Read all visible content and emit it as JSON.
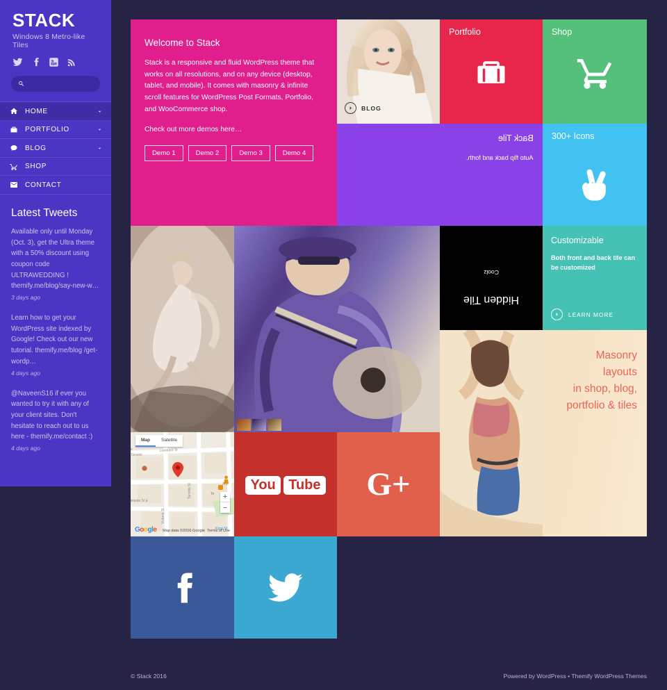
{
  "sidebar": {
    "logo": "STACK",
    "tagline": "Windows 8 Metro-like Tiles",
    "social": [
      {
        "name": "twitter-icon",
        "label": "Twitter"
      },
      {
        "name": "facebook-icon",
        "label": "Facebook"
      },
      {
        "name": "youtube-icon",
        "label": "YouTube"
      },
      {
        "name": "rss-icon",
        "label": "RSS"
      }
    ],
    "search": {
      "placeholder": "",
      "value": "",
      "icon": "search-icon"
    },
    "nav": [
      {
        "label": "HOME",
        "icon": "home-icon",
        "has_chevron": true,
        "active": true
      },
      {
        "label": "PORTFOLIO",
        "icon": "briefcase-icon",
        "has_chevron": true,
        "active": false
      },
      {
        "label": "BLOG",
        "icon": "comment-icon",
        "has_chevron": true,
        "active": false
      },
      {
        "label": "SHOP",
        "icon": "cart-icon",
        "has_chevron": false,
        "active": false
      },
      {
        "label": "CONTACT",
        "icon": "envelope-icon",
        "has_chevron": false,
        "active": false
      }
    ],
    "tweets_title": "Latest Tweets",
    "tweets": [
      {
        "text": "Available only until Monday (Oct. 3), get the Ultra theme with a 50% discount using coupon code ULTRAWEDDING ! themify.me/blog/say-new-w…",
        "ago": "3 days ago"
      },
      {
        "text": "Learn how to get your WordPress site indexed by Google! Check out our new tutorial. themify.me/blog /get-wordp…",
        "ago": "4 days ago"
      },
      {
        "text": "@NaveenS16 if ever you wanted to try it with any of your client sites. Don't hesitate to reach out to us here - themify.me/contact :)",
        "ago": "4 days ago"
      }
    ]
  },
  "tiles": {
    "welcome": {
      "title": "Welcome to Stack",
      "body": "Stack is a responsive and fluid WordPress theme that works on all resolutions, and on any device (desktop, tablet, and mobile). It comes with masonry & infinite scroll features for WordPress Post Formats, Portfolio, and WooCommerce shop.",
      "cta": "Check out more demos here…",
      "buttons": [
        "Demo 1",
        "Demo 2",
        "Demo 3",
        "Demo 4"
      ],
      "color": "#e01e8c"
    },
    "blog": {
      "cta_label": "BLOG",
      "icon": "chevron-right-circle-icon"
    },
    "portfolio": {
      "title": "Portfolio",
      "icon": "briefcase-icon",
      "color": "#e8264c"
    },
    "shop": {
      "title": "Shop",
      "icon": "cart-icon",
      "color": "#55bf7c"
    },
    "back": {
      "title": "Back Tile",
      "subtitle": "Auto flip back and forth.",
      "color": "#8a42e8",
      "mirrored": true
    },
    "icons": {
      "title": "300+ Icons",
      "icon": "peace-hand-icon",
      "color": "#41c2f0"
    },
    "hidden": {
      "small": "Coolz",
      "title": "Hidden Tile",
      "color": "#000000",
      "flipped": true
    },
    "customizable": {
      "title": "Customizable",
      "body": "Both front and back tile can be customized",
      "cta": "LEARN MORE",
      "color": "#45c2b4"
    },
    "masonry": {
      "lines": [
        "Masonry",
        "layouts",
        "in shop, blog,",
        "portfolio & tiles"
      ],
      "text_color": "#e8655b"
    },
    "map": {
      "tab_map": "Map",
      "tab_satellite": "Satellite",
      "logo": "Google",
      "attribution": "Map data ©2016 Google",
      "terms": "Terms of Use",
      "zoom_in": "+",
      "zoom_out": "−",
      "streets": [
        "Lombard St",
        "Toronto St",
        "Victoria St",
        "Adelaide St E",
        "King St"
      ]
    },
    "youtube": {
      "line1": "You",
      "line2": "Tube",
      "color": "#c4302b"
    },
    "gplus": {
      "label": "G+",
      "color": "#e0604c"
    },
    "facebook": {
      "label": "f",
      "color": "#3b5998"
    },
    "twitter": {
      "label": "twitter-bird",
      "color": "#3aa8d0"
    }
  },
  "footer": {
    "copyright": "© Stack 2016",
    "powered_prefix": "Powered by ",
    "powered_link": "WordPress",
    "separator": " • ",
    "themify_link": "Themify WordPress Themes"
  }
}
